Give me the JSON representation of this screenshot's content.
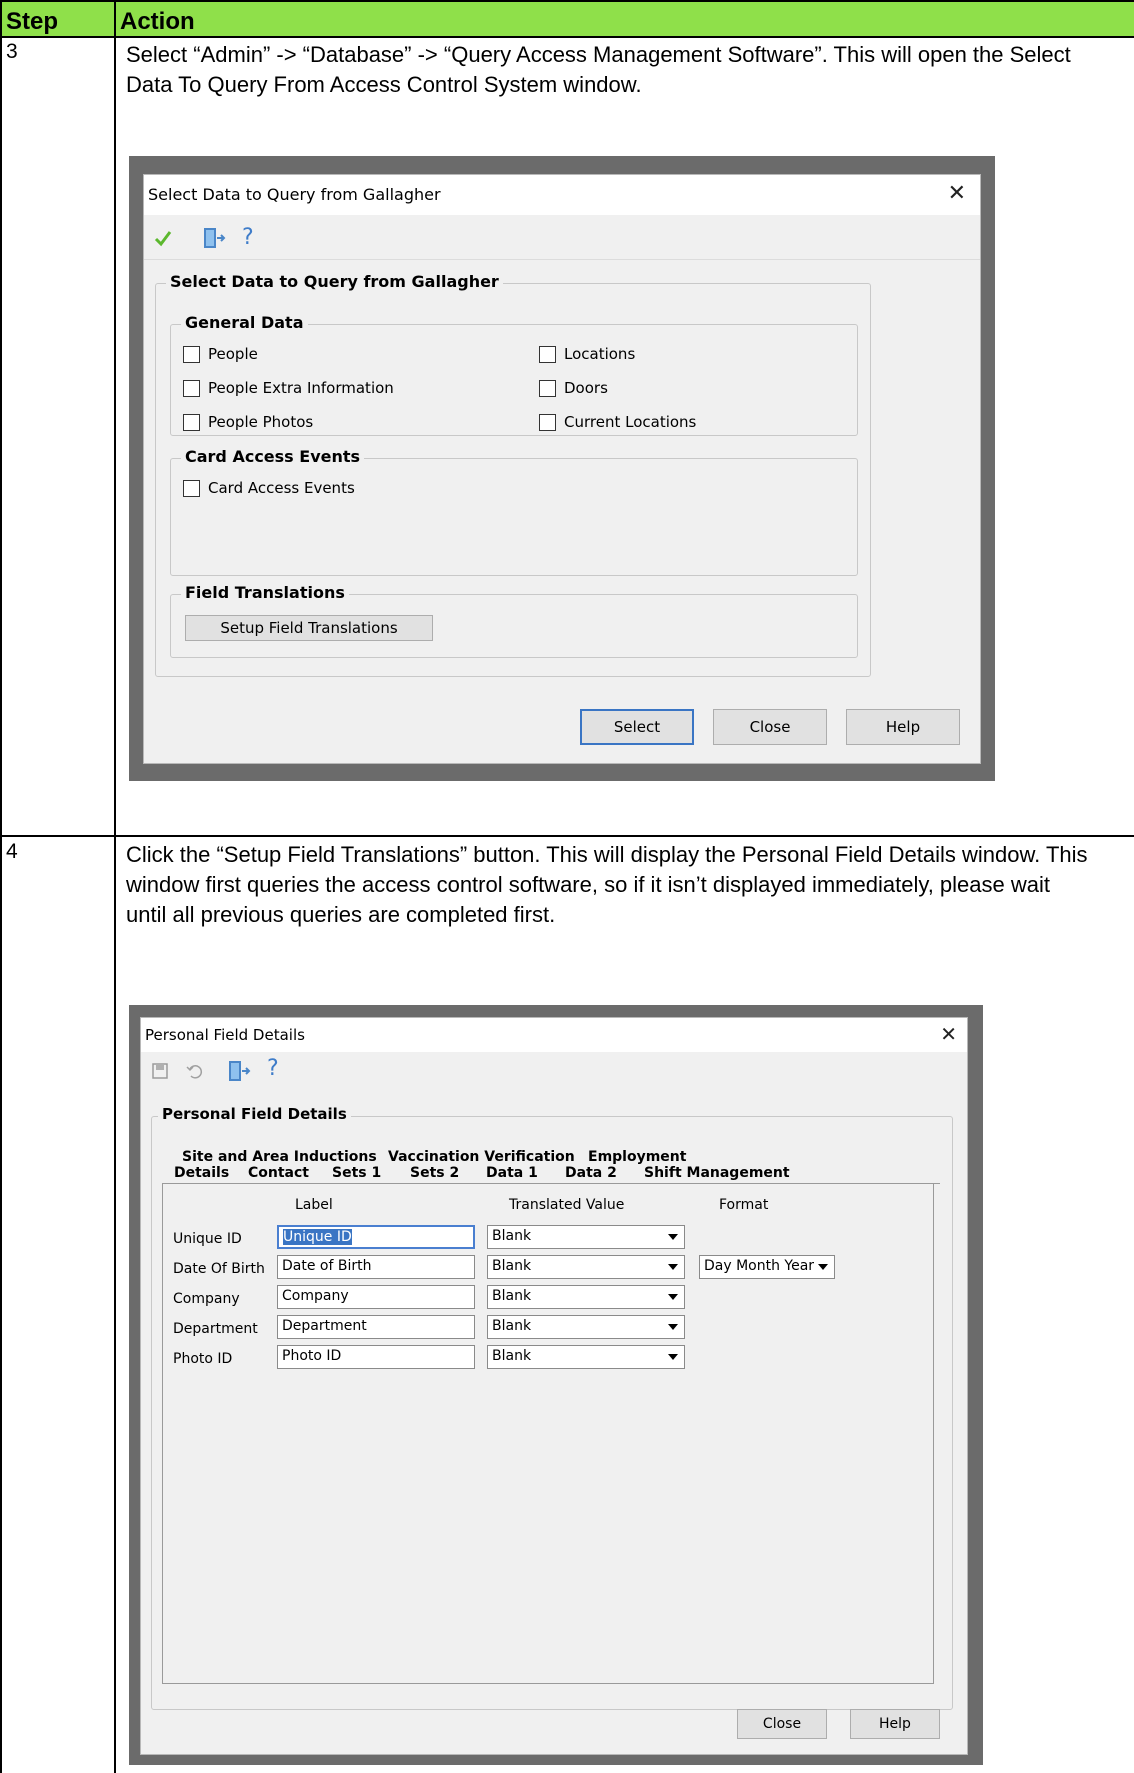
{
  "table": {
    "header_step": "Step",
    "header_action": "Action",
    "header_color": "#8fe04a"
  },
  "rows": [
    {
      "step": "3",
      "text": "Select “Admin” -> “Database” -> “Query Access Management Software”. This will open the Select Data To Query From Access Control System window."
    },
    {
      "step": "4",
      "text": "Click the “Setup Field Translations” button. This will display the Personal Field Details window. This window first queries the access control software, so if it isn’t displayed immediately, please wait until all previous queries are completed first."
    }
  ],
  "dialog1": {
    "title": "Select Data to Query from Gallagher",
    "close_glyph": "✕",
    "toolbar": {
      "ok_icon": "check-icon",
      "exit_icon": "exit-door-icon",
      "help_icon": "help-icon"
    },
    "main_group_title": "Select Data to Query from Gallagher",
    "general_data": {
      "title": "General Data",
      "items": [
        "People",
        "People Extra Information",
        "People Photos",
        "Locations",
        "Doors",
        "Current Locations"
      ]
    },
    "card_access": {
      "title": "Card Access Events",
      "items": [
        "Card Access Events"
      ]
    },
    "field_translations": {
      "title": "Field Translations",
      "button": "Setup Field Translations"
    },
    "buttons": {
      "select": "Select",
      "close": "Close",
      "help": "Help"
    }
  },
  "dialog2": {
    "title": "Personal Field Details",
    "close_glyph": "✕",
    "toolbar": {
      "save_icon": "save-icon",
      "undo_icon": "undo-icon",
      "exit_icon": "exit-door-icon",
      "help_icon": "help-icon"
    },
    "group_title": "Personal Field Details",
    "tabs_back": [
      "Site and Area Inductions",
      "Vaccination Verification",
      "Employment"
    ],
    "tabs_front": [
      "Details",
      "Contact",
      "Sets 1",
      "Sets 2",
      "Data 1",
      "Data 2",
      "Shift Management"
    ],
    "columns": {
      "label": "Label",
      "translated": "Translated Value",
      "format": "Format"
    },
    "fields": [
      {
        "name": "Unique ID",
        "label": "Unique ID",
        "translated": "Blank"
      },
      {
        "name": "Date Of Birth",
        "label": "Date of Birth",
        "translated": "Blank",
        "format": "Day Month Year"
      },
      {
        "name": "Company",
        "label": "Company",
        "translated": "Blank"
      },
      {
        "name": "Department",
        "label": "Department",
        "translated": "Blank"
      },
      {
        "name": "Photo ID",
        "label": "Photo ID",
        "translated": "Blank"
      }
    ],
    "buttons": {
      "close": "Close",
      "help": "Help"
    }
  }
}
